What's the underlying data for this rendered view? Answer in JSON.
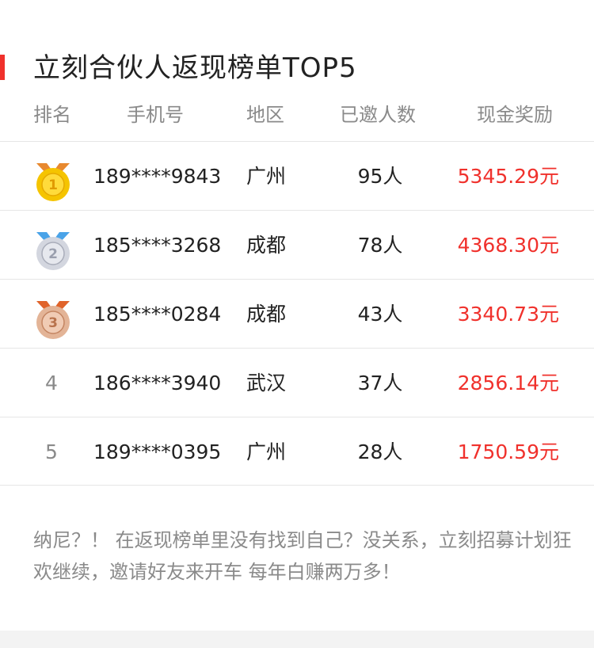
{
  "title": "立刻合伙人返现榜单TOP5",
  "header": {
    "rank": "排名",
    "phone": "手机号",
    "region": "地区",
    "invited": "已邀人数",
    "cash": "现金奖励"
  },
  "rows": [
    {
      "rank": "1",
      "medal": "gold-medal-icon",
      "phone": "189****9843",
      "region": "广州",
      "invited": "95人",
      "cash": "5345.29元"
    },
    {
      "rank": "2",
      "medal": "silver-medal-icon",
      "phone": "185****3268",
      "region": "成都",
      "invited": "78人",
      "cash": "4368.30元"
    },
    {
      "rank": "3",
      "medal": "bronze-medal-icon",
      "phone": "185****0284",
      "region": "成都",
      "invited": "43人",
      "cash": "3340.73元"
    },
    {
      "rank": "4",
      "phone": "186****3940",
      "region": "武汉",
      "invited": "37人",
      "cash": "2856.14元"
    },
    {
      "rank": "5",
      "phone": "189****0395",
      "region": "广州",
      "invited": "28人",
      "cash": "1750.59元"
    }
  ],
  "note": "纳尼？！ 在返现榜单里没有找到自己？没关系，立刻招募计划狂欢继续，邀请好友来开车 每年白赚两万多！",
  "colors": {
    "accent": "#f0312c",
    "gold": "#f5c400",
    "silver": "#c9ccd6",
    "bronze": "#e0ab8e"
  }
}
